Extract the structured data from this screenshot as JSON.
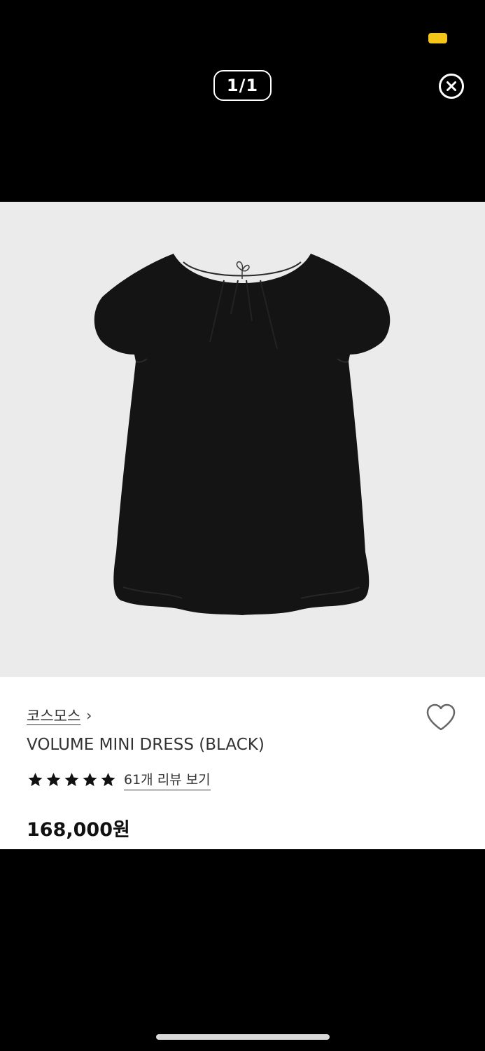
{
  "viewer": {
    "counter": "1/1",
    "close_label": "close"
  },
  "product": {
    "brand": "코스모스",
    "name": "VOLUME MINI DRESS (BLACK)",
    "rating_stars": 5,
    "review_link": "61개 리뷰 보기",
    "price": "168,000원"
  },
  "colors": {
    "background": "#000000",
    "image_bg": "#ebebeb",
    "panel_bg": "#ffffff",
    "status_indicator": "#f5c518",
    "text": "#333333"
  },
  "icons": {
    "close": "close-circle-icon",
    "brand_arrow": "chevron-right-icon",
    "wishlist": "heart-outline-icon",
    "rating": "star-icon"
  }
}
